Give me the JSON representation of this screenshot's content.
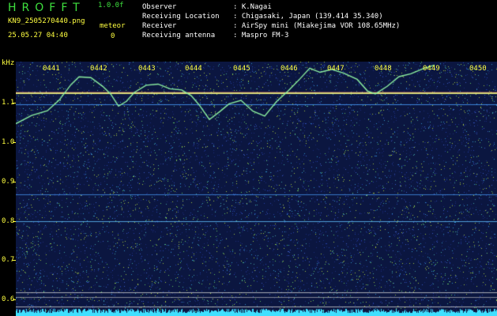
{
  "header": {
    "brand": "HROFFT",
    "version": "1.0.0f",
    "filename": "KN9_2505270440.png",
    "datetime": "25.05.27 04:40",
    "meteor_label": "meteor",
    "meteor_count": "0",
    "fields": [
      {
        "label": "Observer",
        "value": ": K.Nagai"
      },
      {
        "label": "Receiving Location",
        "value": ": Chigasaki, Japan (139.414 35.340)"
      },
      {
        "label": "Receiver",
        "value": ": AirSpy mini (Miakejima VOR 108.65MHz)"
      },
      {
        "label": "Receiving antenna",
        "value": ": Maspro FM-3"
      }
    ]
  },
  "chart_data": {
    "type": "spectrogram",
    "ylabel": "kHz",
    "y_ticks": [
      "1.1",
      "1.0",
      "0.9",
      "0.8",
      "0.7",
      "0.6"
    ],
    "x_ticks": [
      "0441",
      "0442",
      "0443",
      "0444",
      "0445",
      "0446",
      "0447",
      "0448",
      "0449",
      "0450"
    ],
    "ylim": [
      0.585,
      1.22
    ],
    "colors": {
      "background": "#0b1640",
      "noise": "#3a5ac0",
      "carrier": "#f0f080",
      "trace": "#8cf0a0",
      "floor": "#40e0ff"
    }
  }
}
